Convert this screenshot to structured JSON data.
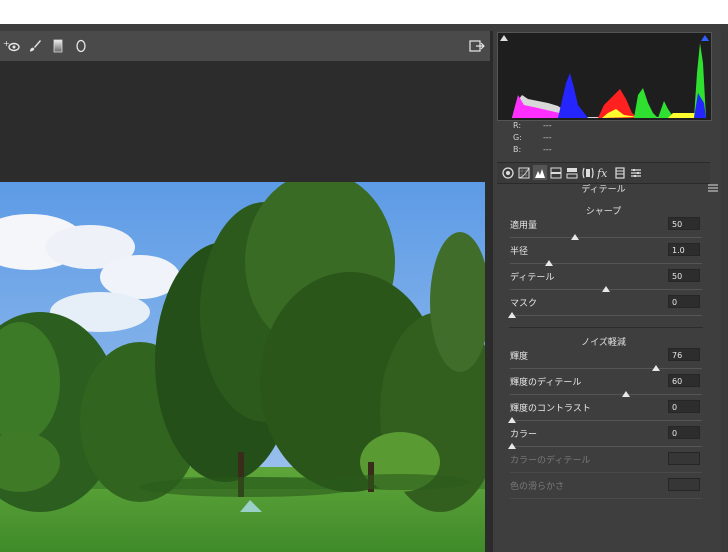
{
  "toolbar": {
    "tools": [
      "target-adjust-icon",
      "brush-icon",
      "graduated-filter-icon",
      "radial-filter-icon"
    ],
    "export_icon": "export-icon"
  },
  "histogram": {
    "colors": {
      "red": "#ff2020",
      "green": "#30e030",
      "blue": "#2020ff",
      "yellow": "#ffff30",
      "magenta": "#ff30ff",
      "white": "#d8d8d8"
    }
  },
  "rgb": [
    {
      "key": "R:",
      "value": "---"
    },
    {
      "key": "G:",
      "value": "---"
    },
    {
      "key": "B:",
      "value": "---"
    }
  ],
  "tabs": [
    "basic-icon",
    "tone-curve-icon",
    "detail-icon",
    "hsl-icon",
    "split-toning-icon",
    "lens-icon",
    "fx-icon",
    "camera-calibration-icon",
    "presets-icon"
  ],
  "panel": {
    "title": "ディテール",
    "sharpen": {
      "title": "シャープ",
      "sliders": [
        {
          "label": "適用量",
          "value": "50",
          "fraction": 0.33
        },
        {
          "label": "半径",
          "value": "1.0",
          "fraction": 0.2
        },
        {
          "label": "ディテール",
          "value": "50",
          "fraction": 0.5
        },
        {
          "label": "マスク",
          "value": "0",
          "fraction": 0.0
        }
      ]
    },
    "noise": {
      "title": "ノイズ軽減",
      "sliders": [
        {
          "label": "輝度",
          "value": "76",
          "fraction": 0.76
        },
        {
          "label": "輝度のディテール",
          "value": "60",
          "fraction": 0.6
        },
        {
          "label": "輝度のコントラスト",
          "value": "0",
          "fraction": 0.0
        },
        {
          "label": "カラー",
          "value": "0",
          "fraction": 0.0
        }
      ],
      "disabled": [
        {
          "label": "カラーのディテール",
          "value": ""
        },
        {
          "label": "色の滑らかさ",
          "value": ""
        }
      ]
    }
  }
}
